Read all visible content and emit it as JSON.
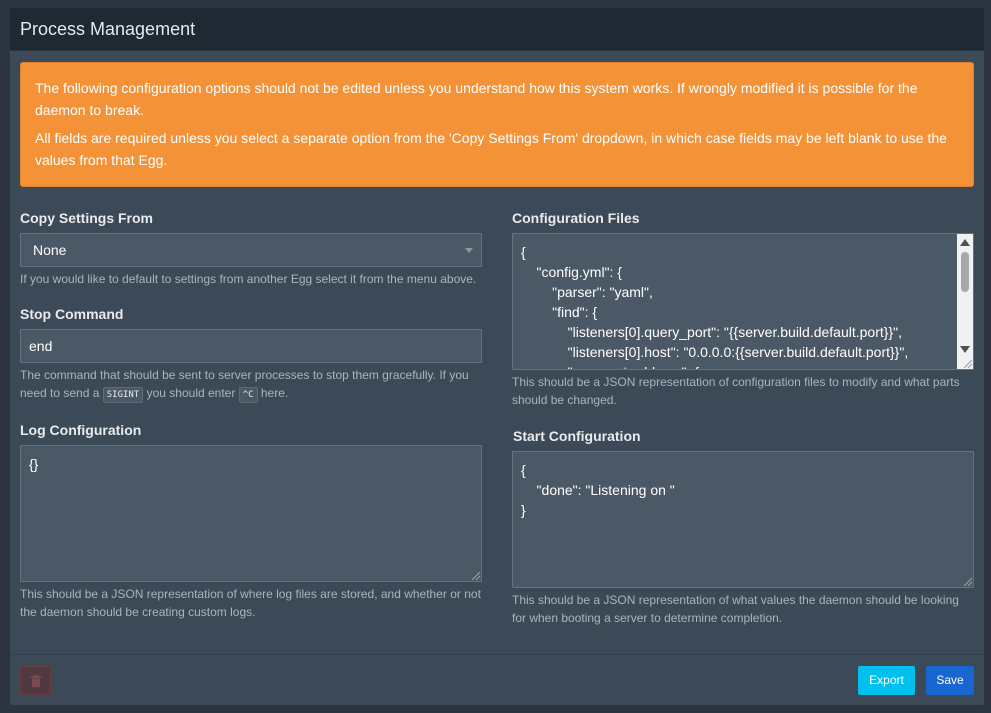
{
  "header": {
    "title": "Process Management"
  },
  "alert": {
    "line1": "The following configuration options should not be edited unless you understand how this system works. If wrongly modified it is possible for the daemon to break.",
    "line2": "All fields are required unless you select a separate option from the 'Copy Settings From' dropdown, in which case fields may be left blank to use the values from that Egg."
  },
  "copy_settings": {
    "label": "Copy Settings From",
    "selected": "None",
    "help": "If you would like to default to settings from another Egg select it from the menu above."
  },
  "stop_command": {
    "label": "Stop Command",
    "value": "end",
    "help_pre": "The command that should be sent to server processes to stop them gracefully. If you need to send a",
    "help_code1": "SIGINT",
    "help_mid": "you should enter",
    "help_code2": "^C",
    "help_post": "here."
  },
  "log_config": {
    "label": "Log Configuration",
    "value": "{}",
    "help": "This should be a JSON representation of where log files are stored, and whether or not the daemon should be creating custom logs."
  },
  "config_files": {
    "label": "Configuration Files",
    "value": "{\n    \"config.yml\": {\n        \"parser\": \"yaml\",\n        \"find\": {\n            \"listeners[0].query_port\": \"{{server.build.default.port}}\",\n            \"listeners[0].host\": \"0.0.0.0:{{server.build.default.port}}\",\n            \"servers.*.address\": {",
    "help": "This should be a JSON representation of configuration files to modify and what parts should be changed."
  },
  "start_config": {
    "label": "Start Configuration",
    "value": "{\n    \"done\": \"Listening on \"\n}",
    "help": "This should be a JSON representation of what values the daemon should be looking for when booting a server to determine completion."
  },
  "footer": {
    "delete_icon": "trash-icon",
    "export_label": "Export",
    "save_label": "Save"
  },
  "colors": {
    "alert": "#f39237",
    "export": "#00c0ef",
    "save": "#1766d1",
    "panel": "#3c4957",
    "header": "#1f2933"
  }
}
